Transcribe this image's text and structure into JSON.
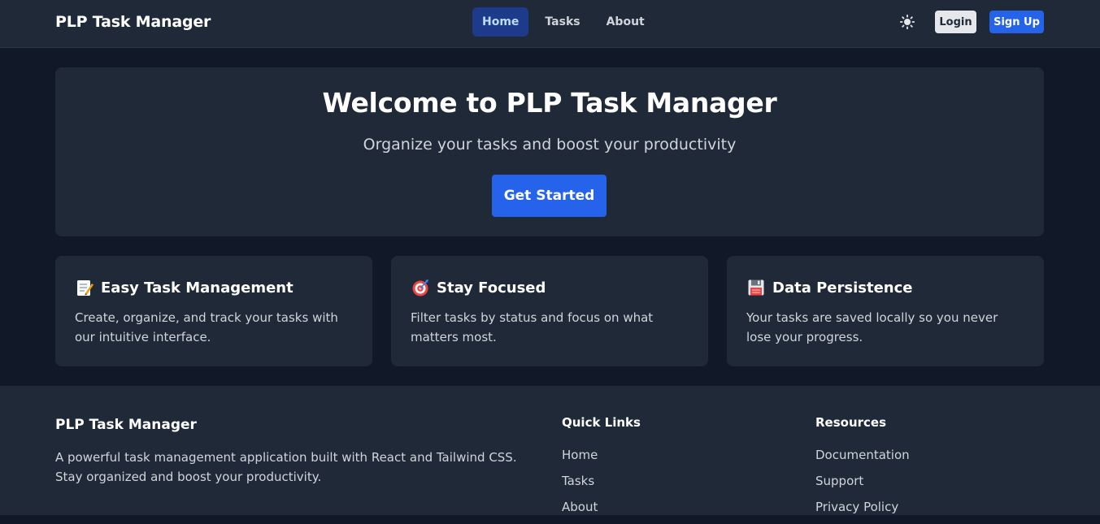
{
  "nav": {
    "brand": "PLP Task Manager",
    "links": [
      {
        "label": "Home"
      },
      {
        "label": "Tasks"
      },
      {
        "label": "About"
      }
    ],
    "theme_icon": "sun-icon",
    "login_label": "Login",
    "signup_label": "Sign Up"
  },
  "hero": {
    "title": "Welcome to PLP Task Manager",
    "subtitle": "Organize your tasks and boost your productivity",
    "cta_label": "Get Started"
  },
  "features": [
    {
      "icon": "memo-icon",
      "title": "Easy Task Management",
      "description": "Create, organize, and track your tasks with our intuitive interface."
    },
    {
      "icon": "target-icon",
      "title": "Stay Focused",
      "description": "Filter tasks by status and focus on what matters most."
    },
    {
      "icon": "floppy-disk-icon",
      "title": "Data Persistence",
      "description": "Your tasks are saved locally so you never lose your progress."
    }
  ],
  "footer": {
    "brand": "PLP Task Manager",
    "description": "A powerful task management application built with React and Tailwind CSS. Stay organized and boost your productivity.",
    "quick_links": {
      "title": "Quick Links",
      "items": [
        "Home",
        "Tasks",
        "About"
      ]
    },
    "resources": {
      "title": "Resources",
      "items": [
        "Documentation",
        "Support",
        "Privacy Policy"
      ]
    }
  },
  "colors": {
    "background": "#111827",
    "surface": "#1f2937",
    "accent": "#2563eb",
    "active_nav": "#1e3a8a"
  }
}
